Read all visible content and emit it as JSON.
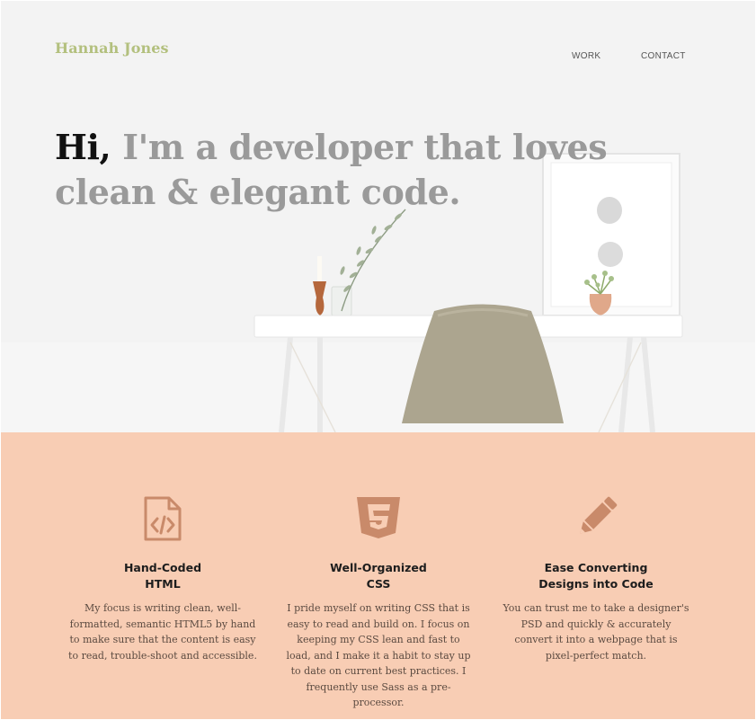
{
  "brand": {
    "name": "Hannah Jones",
    "color": "#b3c07e"
  },
  "nav": {
    "items": [
      {
        "label": "WORK"
      },
      {
        "label": "CONTACT"
      }
    ]
  },
  "hero": {
    "greeting": "Hi,",
    "tagline": " I'm a developer that loves clean & elegant code."
  },
  "services": {
    "background": "#f8cdb4",
    "icon_color": "#c98a6a",
    "items": [
      {
        "icon": "code-file-icon",
        "title_line1": "Hand-Coded",
        "title_line2": "HTML",
        "description": "My focus is writing clean, well-formatted, semantic HTML5 by hand to make sure that the content is easy to read, trouble-shoot and accessible."
      },
      {
        "icon": "css3-icon",
        "title_line1": "Well-Organized",
        "title_line2": "CSS",
        "description": "I pride myself on writing CSS that is easy to read and build on. I focus on keeping my CSS lean and fast to load, and I make it a habit to stay up to date on current best practices. I frequently use Sass as a pre-processor."
      },
      {
        "icon": "pencil-icon",
        "title_line1": "Ease Converting",
        "title_line2": "Designs into Code",
        "description": "You can trust me to take a designer's PSD and quickly & accurately convert it into a webpage that is pixel-perfect match."
      }
    ]
  }
}
